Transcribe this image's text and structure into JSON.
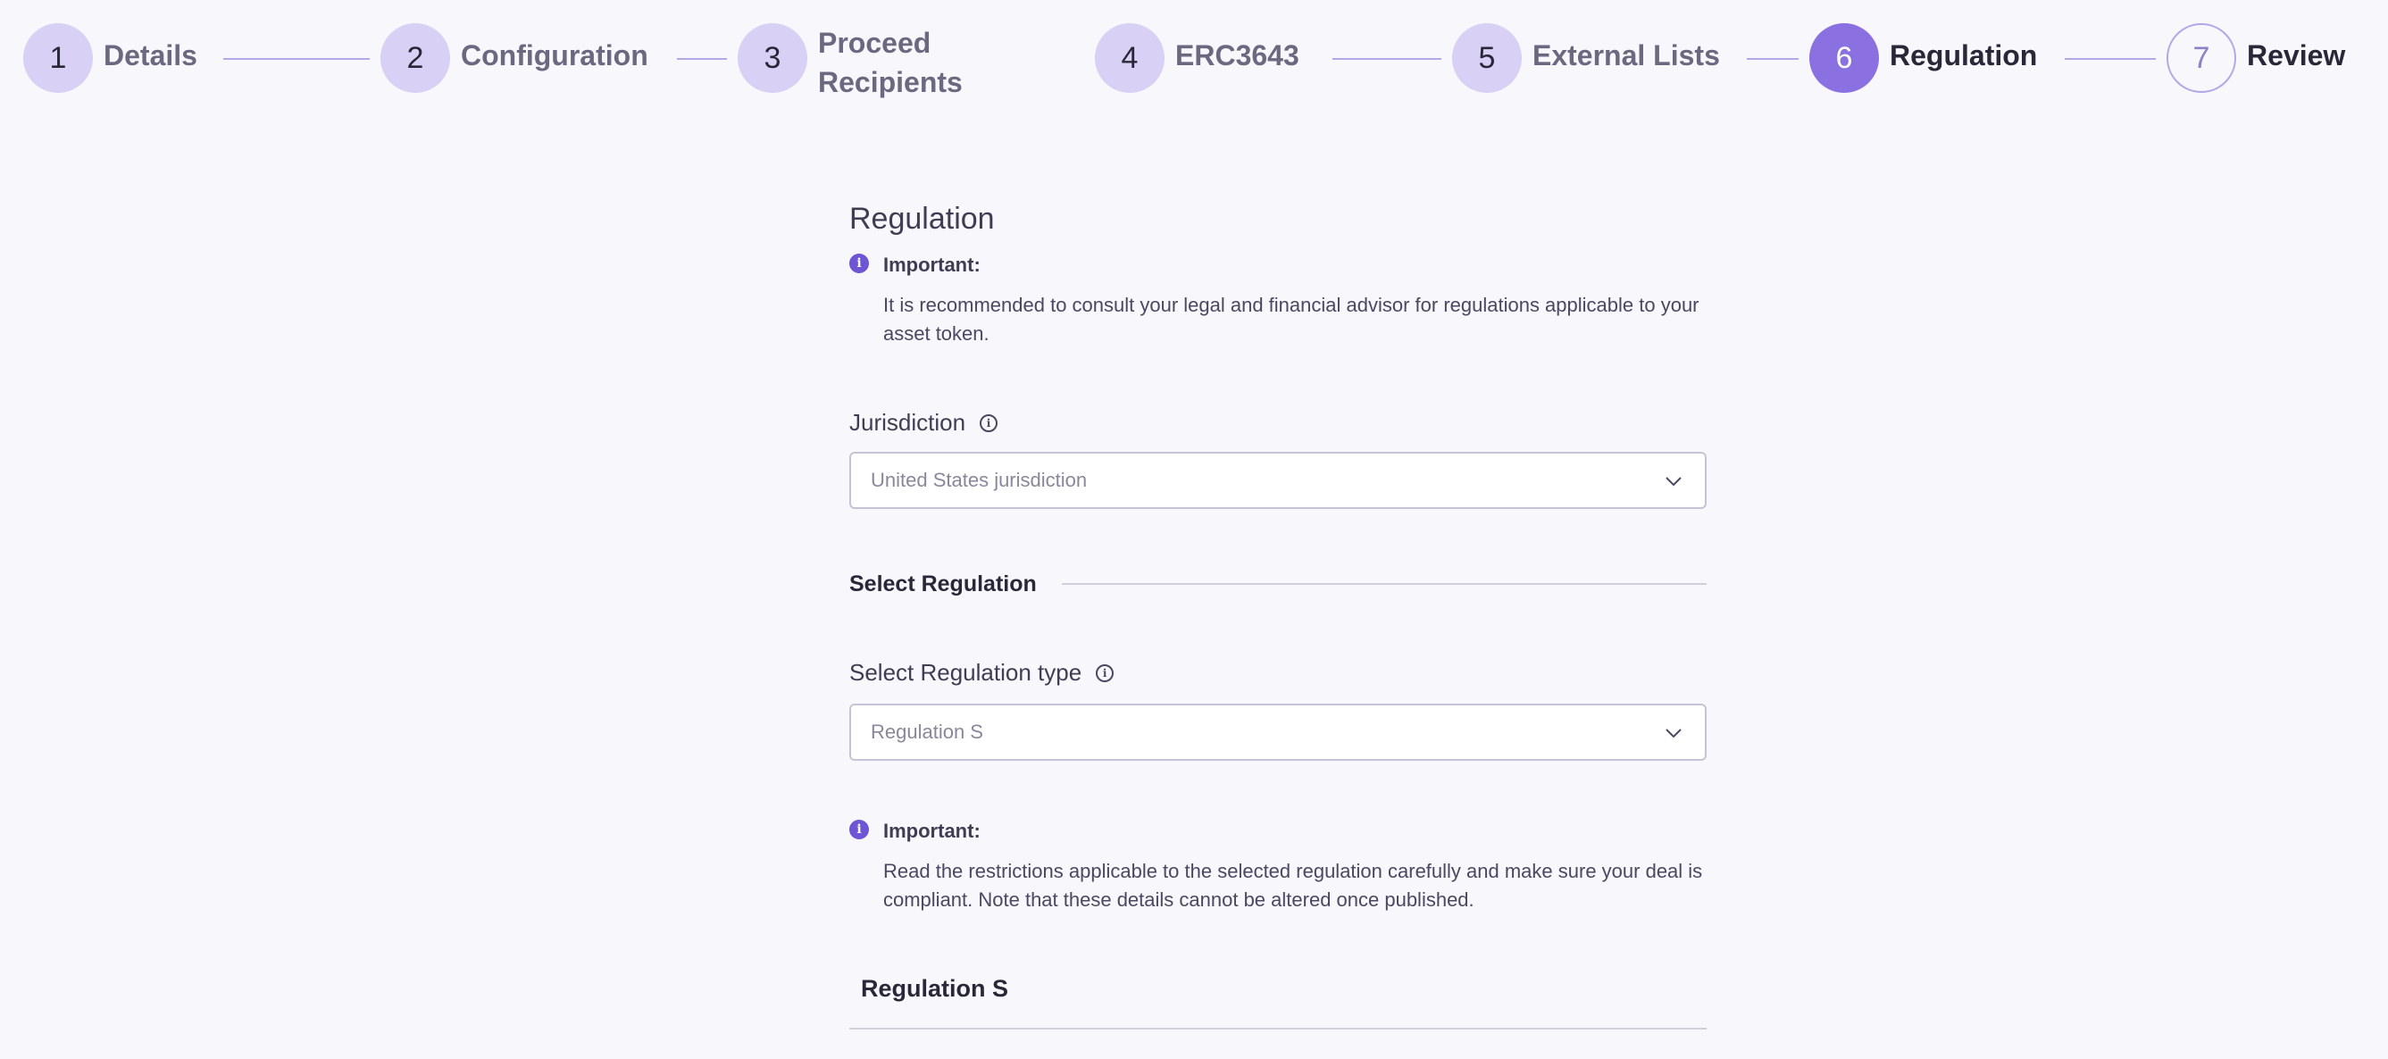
{
  "stepper": {
    "steps": [
      {
        "number": "1",
        "label": "Details",
        "state": "completed"
      },
      {
        "number": "2",
        "label": "Configuration",
        "state": "completed"
      },
      {
        "number": "3",
        "label_line1": "Proceed",
        "label_line2": "Recipients",
        "state": "completed"
      },
      {
        "number": "4",
        "label": "ERC3643",
        "state": "completed"
      },
      {
        "number": "5",
        "label": "External Lists",
        "state": "completed"
      },
      {
        "number": "6",
        "label": "Regulation",
        "state": "active"
      },
      {
        "number": "7",
        "label": "Review",
        "state": "upcoming"
      }
    ]
  },
  "regulation": {
    "title": "Regulation",
    "important_label": "Important:",
    "important_text": "It is recommended to consult your legal and financial advisor for regulations applicable to your asset token.",
    "jurisdiction_label": "Jurisdiction",
    "jurisdiction_placeholder": "United States jurisdiction",
    "select_regulation_heading": "Select Regulation",
    "regulation_type_label": "Select Regulation type",
    "regulation_type_value": "Regulation S",
    "important2_label": "Important:",
    "important2_text": "Read the restrictions applicable to the selected regulation carefully and make sure your deal is compliant. Note that these details cannot be altered once published.",
    "selected_regulation_title": "Regulation S"
  },
  "icons": {
    "info": "info-icon",
    "help": "help-circle-icon",
    "chevron": "chevron-down-icon"
  },
  "colors": {
    "accent": "#8a70e0",
    "step_completed": "#d8d0f5",
    "background": "#f8f7fc"
  }
}
